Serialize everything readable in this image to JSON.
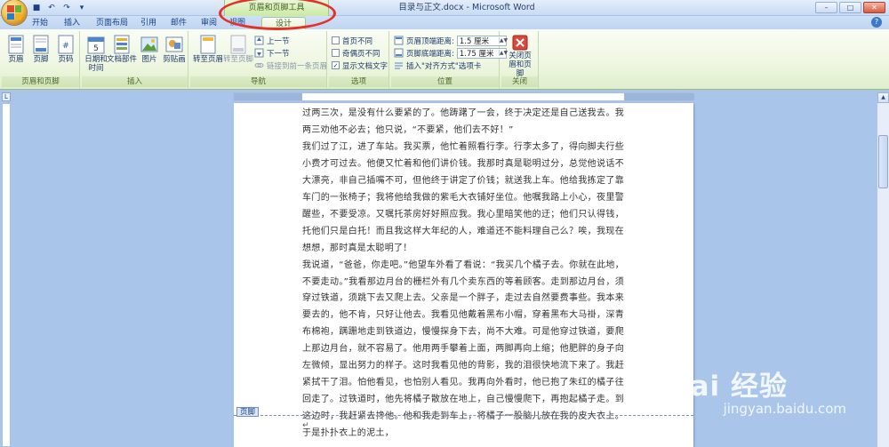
{
  "titlebar": {
    "context_tool_title": "页眉和页脚工具",
    "document_title": "目录与正文.docx - Microsoft Word",
    "qat_icons": [
      "save-icon",
      "undo-icon",
      "redo-icon",
      "customize-icon"
    ],
    "window_controls": [
      "minimize",
      "maximize",
      "close"
    ]
  },
  "tabs": [
    "开始",
    "插入",
    "页面布局",
    "引用",
    "邮件",
    "审阅",
    "视图",
    "设计"
  ],
  "ribbon": {
    "groups": {
      "header_footer": {
        "label": "页眉和页脚",
        "buttons": [
          "页眉",
          "页脚",
          "页码"
        ]
      },
      "insert": {
        "label": "插入",
        "buttons": [
          "日期和时间",
          "文档部件",
          "图片",
          "剪贴画"
        ]
      },
      "navigation": {
        "label": "导航",
        "buttons": [
          "转至页眉",
          "转至页脚"
        ],
        "small": [
          "上一节",
          "下一节",
          "链接到前一条页眉"
        ]
      },
      "options": {
        "label": "选项",
        "checks": [
          {
            "label": "首页不同",
            "checked": false
          },
          {
            "label": "奇偶页不同",
            "checked": false
          },
          {
            "label": "显示文档文字",
            "checked": true
          }
        ]
      },
      "position": {
        "label": "位置",
        "header_distance_label": "页眉顶端距离:",
        "header_distance_value": "1.5 厘米",
        "footer_distance_label": "页脚底端距离:",
        "footer_distance_value": "1.75 厘米",
        "insert_align_tab": "插入\"对齐方式\"选项卡"
      },
      "close": {
        "label": "关闭",
        "button": "关闭页眉和页脚"
      }
    }
  },
  "document": {
    "paragraphs": [
      "过两三次，是没有什么要紧的了。他踌躇了一会，终于决定还是自己送我去。我两三劝他不必去；他只说，“不要紧，他们去不好！”",
      "我们过了江，进了车站。我买票，他忙着照看行李。行李太多了，得向脚夫行些小费才可过去。他便又忙着和他们讲价钱。我那时真是聪明过分，总觉他说话不大漂亮，非自己插嘴不可，但他终于讲定了价钱；就送我上车。他给我拣定了靠车门的一张椅子；我将他给我做的紫毛大衣铺好坐位。他嘱我路上小心，夜里警醒些，不要受凉。又嘱托茶房好好照应我。我心里暗笑他的迂；他们只认得钱，托他们只是白托！而且我这样大年纪的人，难道还不能料理自己么？唉，我现在想想，那时真是太聪明了！",
      "我说道，“爸爸，你走吧。”他望车外看了看说：“我买几个橘子去。你就在此地，不要走动。”我看那边月台的栅栏外有几个卖东西的等着顾客。走到那边月台，须穿过铁道，须跳下去又爬上去。父亲是一个胖子，走过去自然要费事些。我本来要去的，他不肯，只好让他去。我看见他戴着黑布小帽，穿着黑布大马褂，深青布棉袍，蹒跚地走到铁道边，慢慢探身下去，尚不大难。可是他穿过铁道，要爬上那边月台，就不容易了。他用两手攀着上面，两脚再向上缩；他肥胖的身子向左微倾，显出努力的样子。这时我看见他的背影，我的泪很快地流下来了。我赶紧拭干了泪。怕他看见，也怕别人看见。我再向外看时，他已抱了朱红的橘子往回走了。过铁道时，他先将橘子散放在地上，自己慢慢爬下，再抱起橘子走。到这边时，我赶紧去搀他。他和我走到车上，将橘子一股脑儿放在我的皮大衣上。于是扑扑衣上的泥土，"
    ],
    "footer_tag": "页脚",
    "paragraph_mark": "↵"
  },
  "watermark": {
    "brand": "Bai 经验",
    "url": "jingyan.baidu.com"
  },
  "colors": {
    "context_green": "#cbe9a6",
    "highlight_red": "#e53027",
    "ribbon_blue": "#15428b"
  }
}
